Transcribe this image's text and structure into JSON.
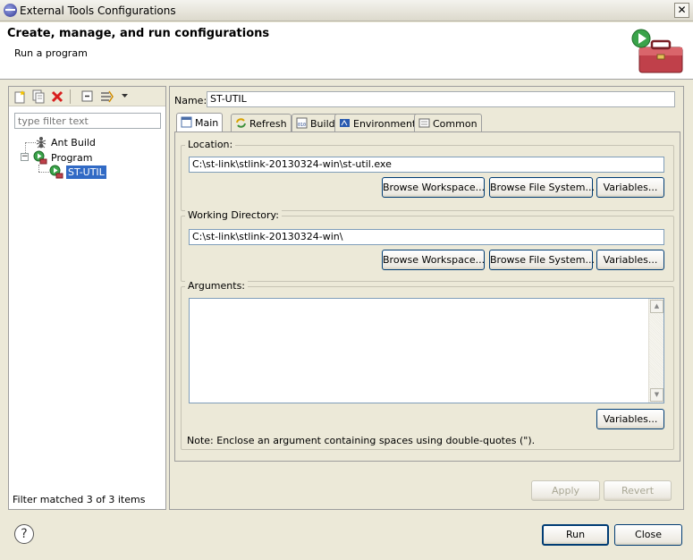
{
  "window": {
    "title": "External Tools Configurations",
    "close_glyph": "✕"
  },
  "header": {
    "title": "Create, manage, and run configurations",
    "subtitle": "Run a program"
  },
  "left": {
    "toolbar": {
      "new_icon": "new-config-icon",
      "duplicate_icon": "duplicate-icon",
      "delete_icon": "delete-icon",
      "collapse_icon": "collapse-all-icon",
      "filter_icon": "filter-icon"
    },
    "filter_placeholder": "type filter text",
    "tree": {
      "ant_build": "Ant Build",
      "program": "Program",
      "st_util": "ST-UTIL"
    },
    "status": "Filter matched 3 of 3 items"
  },
  "right": {
    "name_label": "Name:",
    "name_value": "ST-UTIL",
    "tabs": [
      {
        "label": "Main"
      },
      {
        "label": "Refresh"
      },
      {
        "label": "Build"
      },
      {
        "label": "Environment"
      },
      {
        "label": "Common"
      }
    ],
    "location": {
      "label": "Location:",
      "value": "C:\\st-link\\stlink-20130324-win\\st-util.exe"
    },
    "working_dir": {
      "label": "Working Directory:",
      "value": "C:\\st-link\\stlink-20130324-win\\"
    },
    "arguments": {
      "label": "Arguments:",
      "value": "",
      "note": "Note: Enclose an argument containing spaces using double-quotes (\")."
    },
    "buttons": {
      "browse_workspace": "Browse Workspace...",
      "browse_file_system": "Browse File System...",
      "variables": "Variables...",
      "apply": "Apply",
      "revert": "Revert"
    }
  },
  "footer": {
    "help_glyph": "?",
    "run": "Run",
    "close": "Close"
  },
  "colors": {
    "selection": "#316ac5",
    "dialog_bg": "#ece9d8"
  }
}
